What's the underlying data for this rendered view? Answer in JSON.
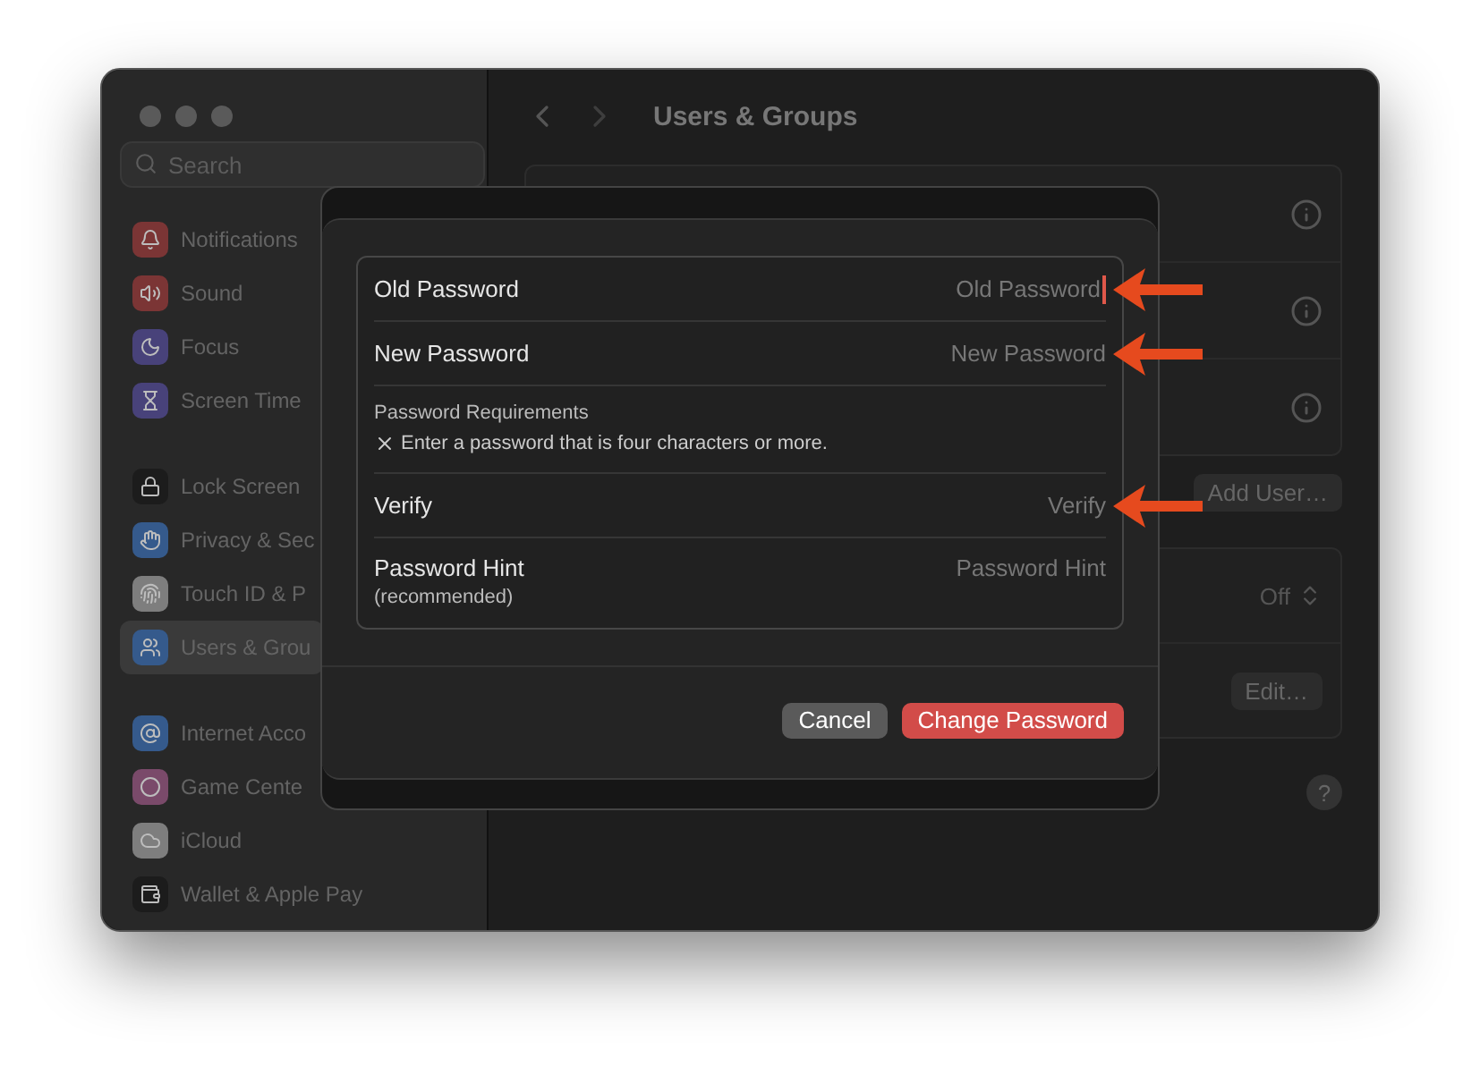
{
  "sidebar": {
    "search": {
      "placeholder": "Search"
    },
    "groups": [
      [
        {
          "label": "Notifications",
          "color": "#7b3535",
          "selected": false
        },
        {
          "label": "Sound",
          "color": "#7b3535",
          "selected": false
        },
        {
          "label": "Focus",
          "color": "#48427a",
          "selected": false
        },
        {
          "label": "Screen Time",
          "color": "#48427a",
          "selected": false
        }
      ],
      [
        {
          "label": "Lock Screen",
          "color": "#1c1c1c",
          "selected": false
        },
        {
          "label": "Privacy & Sec",
          "color": "#355a8c",
          "selected": false
        },
        {
          "label": "Touch ID & P",
          "color": "#7e7e7e",
          "selected": false
        },
        {
          "label": "Users & Grou",
          "color": "#355a8c",
          "selected": true
        }
      ],
      [
        {
          "label": "Internet Acco",
          "color": "#355a8c",
          "selected": false
        },
        {
          "label": "Game Cente",
          "color": "#7a4a6a",
          "selected": false
        },
        {
          "label": "iCloud",
          "color": "#7e7e7e",
          "selected": false
        },
        {
          "label": "Wallet & Apple Pay",
          "color": "#1c1c1c",
          "selected": false
        }
      ]
    ]
  },
  "main": {
    "title": "Users & Groups",
    "add_button": "Add User…",
    "auto_login_value": "Off",
    "edit_button": "Edit…",
    "help": "?"
  },
  "dialog": {
    "rows": [
      {
        "kind": "field",
        "label": "Old Password",
        "placeholder": "Old Password",
        "focused": true,
        "arrow": true
      },
      {
        "kind": "field",
        "label": "New Password",
        "placeholder": "New Password",
        "focused": false,
        "arrow": true
      },
      {
        "kind": "note",
        "title": "Password Requirements",
        "items": [
          {
            "text": "Enter a password that is four characters or more.",
            "met": false
          }
        ]
      },
      {
        "kind": "field",
        "label": "Verify",
        "placeholder": "Verify",
        "focused": false,
        "arrow": true
      },
      {
        "kind": "field",
        "label": "Password Hint",
        "sublabel": "(recommended)",
        "placeholder": "Password Hint",
        "focused": false,
        "arrow": false
      }
    ],
    "buttons": [
      {
        "label": "Cancel",
        "kind": "secondary"
      },
      {
        "label": "Change Password",
        "kind": "primary"
      }
    ]
  }
}
